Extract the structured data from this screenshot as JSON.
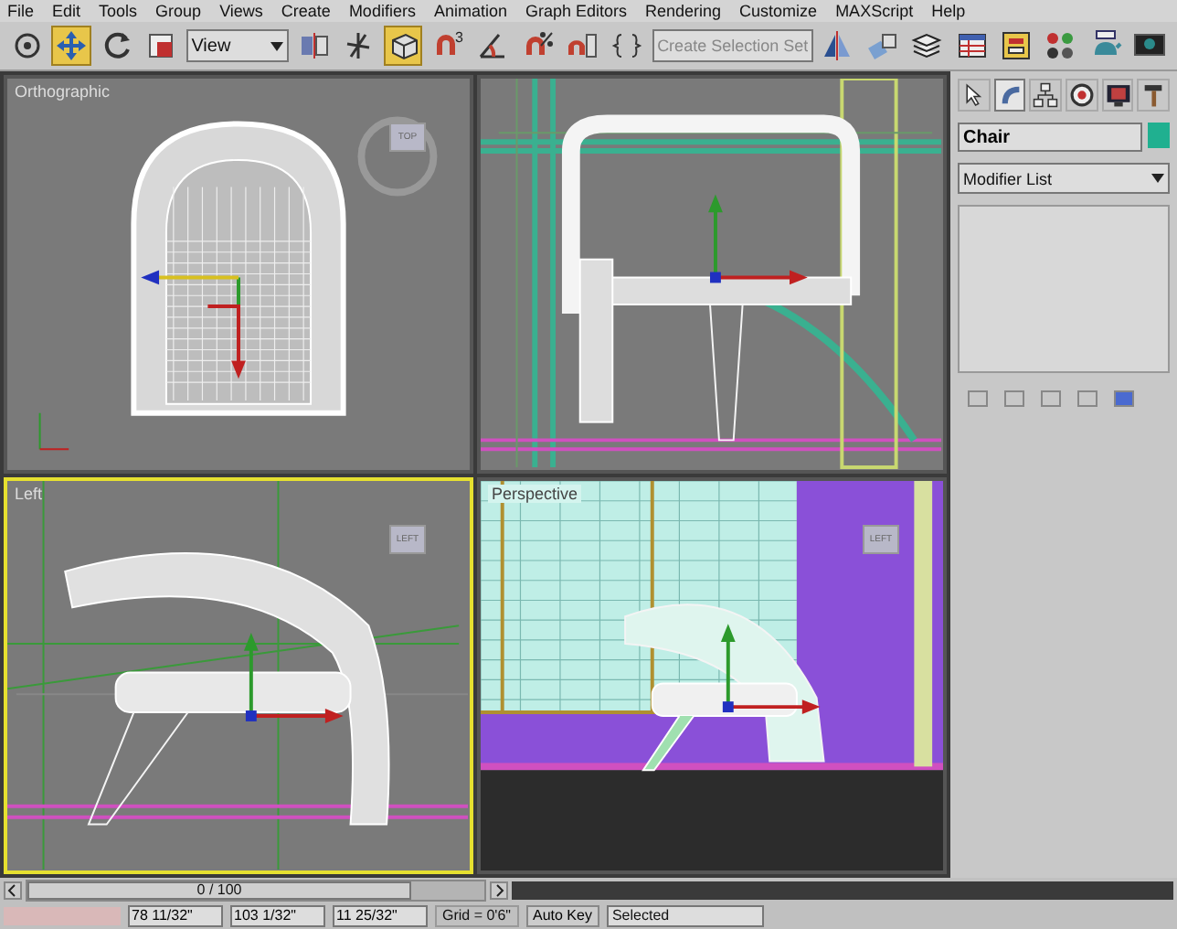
{
  "menu": [
    "File",
    "Edit",
    "Tools",
    "Group",
    "Views",
    "Create",
    "Modifiers",
    "Animation",
    "Graph Editors",
    "Rendering",
    "Customize",
    "MAXScript",
    "Help"
  ],
  "toolbar": {
    "tools": [
      {
        "kind": "select",
        "selected": false
      },
      {
        "kind": "move",
        "selected": true
      },
      {
        "kind": "rotate",
        "selected": false
      },
      {
        "kind": "scale",
        "selected": false
      },
      {
        "kind": "dropdown",
        "value": "View"
      },
      {
        "kind": "pivot",
        "selected": false
      },
      {
        "kind": "manipulate",
        "selected": false
      },
      {
        "kind": "cube",
        "selected": true
      },
      {
        "kind": "snap",
        "label": "3",
        "selected": false
      },
      {
        "kind": "angle",
        "selected": false
      },
      {
        "kind": "percent",
        "selected": false
      },
      {
        "kind": "spinner",
        "selected": false
      },
      {
        "kind": "named",
        "selected": false
      },
      {
        "kind": "field",
        "placeholder": "Create Selection Set"
      },
      {
        "kind": "mirror",
        "selected": false
      },
      {
        "kind": "align",
        "selected": false
      },
      {
        "kind": "layers",
        "selected": false
      },
      {
        "kind": "table",
        "selected": false
      },
      {
        "kind": "schematic",
        "selected": false
      },
      {
        "kind": "spheres",
        "selected": false
      },
      {
        "kind": "teapot",
        "selected": false
      },
      {
        "kind": "screen",
        "selected": false
      }
    ]
  },
  "viewports": [
    {
      "kind": "front",
      "label": "Orthographic",
      "viewcube": "TOP",
      "selected": false
    },
    {
      "kind": "top",
      "selected": false
    },
    {
      "kind": "left",
      "label": "Left",
      "viewcube": "LEFT",
      "selected": true
    },
    {
      "kind": "perspective",
      "label": "Perspective",
      "viewcube": "LEFT",
      "selected": false
    }
  ],
  "command_panel": {
    "tabs": [
      {
        "kind": "cursor",
        "selected": false
      },
      {
        "kind": "bend",
        "selected": true
      },
      {
        "kind": "hierarchy",
        "selected": false
      },
      {
        "kind": "motion",
        "selected": false
      },
      {
        "kind": "display",
        "selected": false
      },
      {
        "kind": "hammer",
        "selected": false
      }
    ],
    "object_name": "Chair",
    "modifier_list": "Modifier List"
  },
  "timeline": {
    "frame": "0 / 100"
  },
  "status": {
    "x": "78 11/32\"",
    "y": "103 1/32\"",
    "z": "11 25/32\"",
    "grid": "Grid = 0'6\"",
    "auto_key": "Auto Key",
    "key_filter": "Selected"
  }
}
